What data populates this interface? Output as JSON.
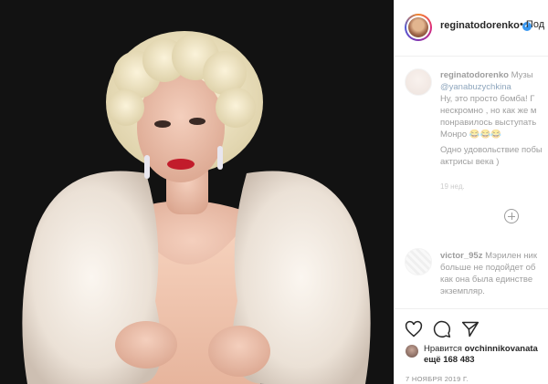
{
  "post": {
    "username": "reginatodorenko",
    "follow_text": "• Под"
  },
  "caption": {
    "username": "reginatodorenko",
    "text_after_username": "Музы",
    "mention": "@yanabuzychkina",
    "lines": [
      "Ну, это просто бомба! Г",
      "нескромно , но как же м",
      "понравилось выступать",
      "Монро 😂😂😂",
      "Одно удовольствие побы",
      "актрисы века )"
    ],
    "time": "19 нед."
  },
  "comment": {
    "username": "victor_95z",
    "text_after_username": "Мэрилен ник",
    "lines": [
      "больше не подойдет об",
      "как она была единстве",
      "экземпляр."
    ]
  },
  "likes": {
    "prefix": "Нравится",
    "liked_by": "ovchinnikovanata",
    "count_line": "ещё 168 483"
  },
  "date": "7 НОЯБРЯ 2019 Г.",
  "icons": {
    "verified": "verified-badge-icon",
    "add_comment": "plus-circle-icon",
    "like": "heart-icon",
    "comment": "comment-bubble-icon",
    "share": "paper-plane-icon"
  },
  "colors": {
    "verified": "#3897f0",
    "text": "#262626",
    "muted": "#8e8e8e",
    "photo_background": "#121212"
  }
}
